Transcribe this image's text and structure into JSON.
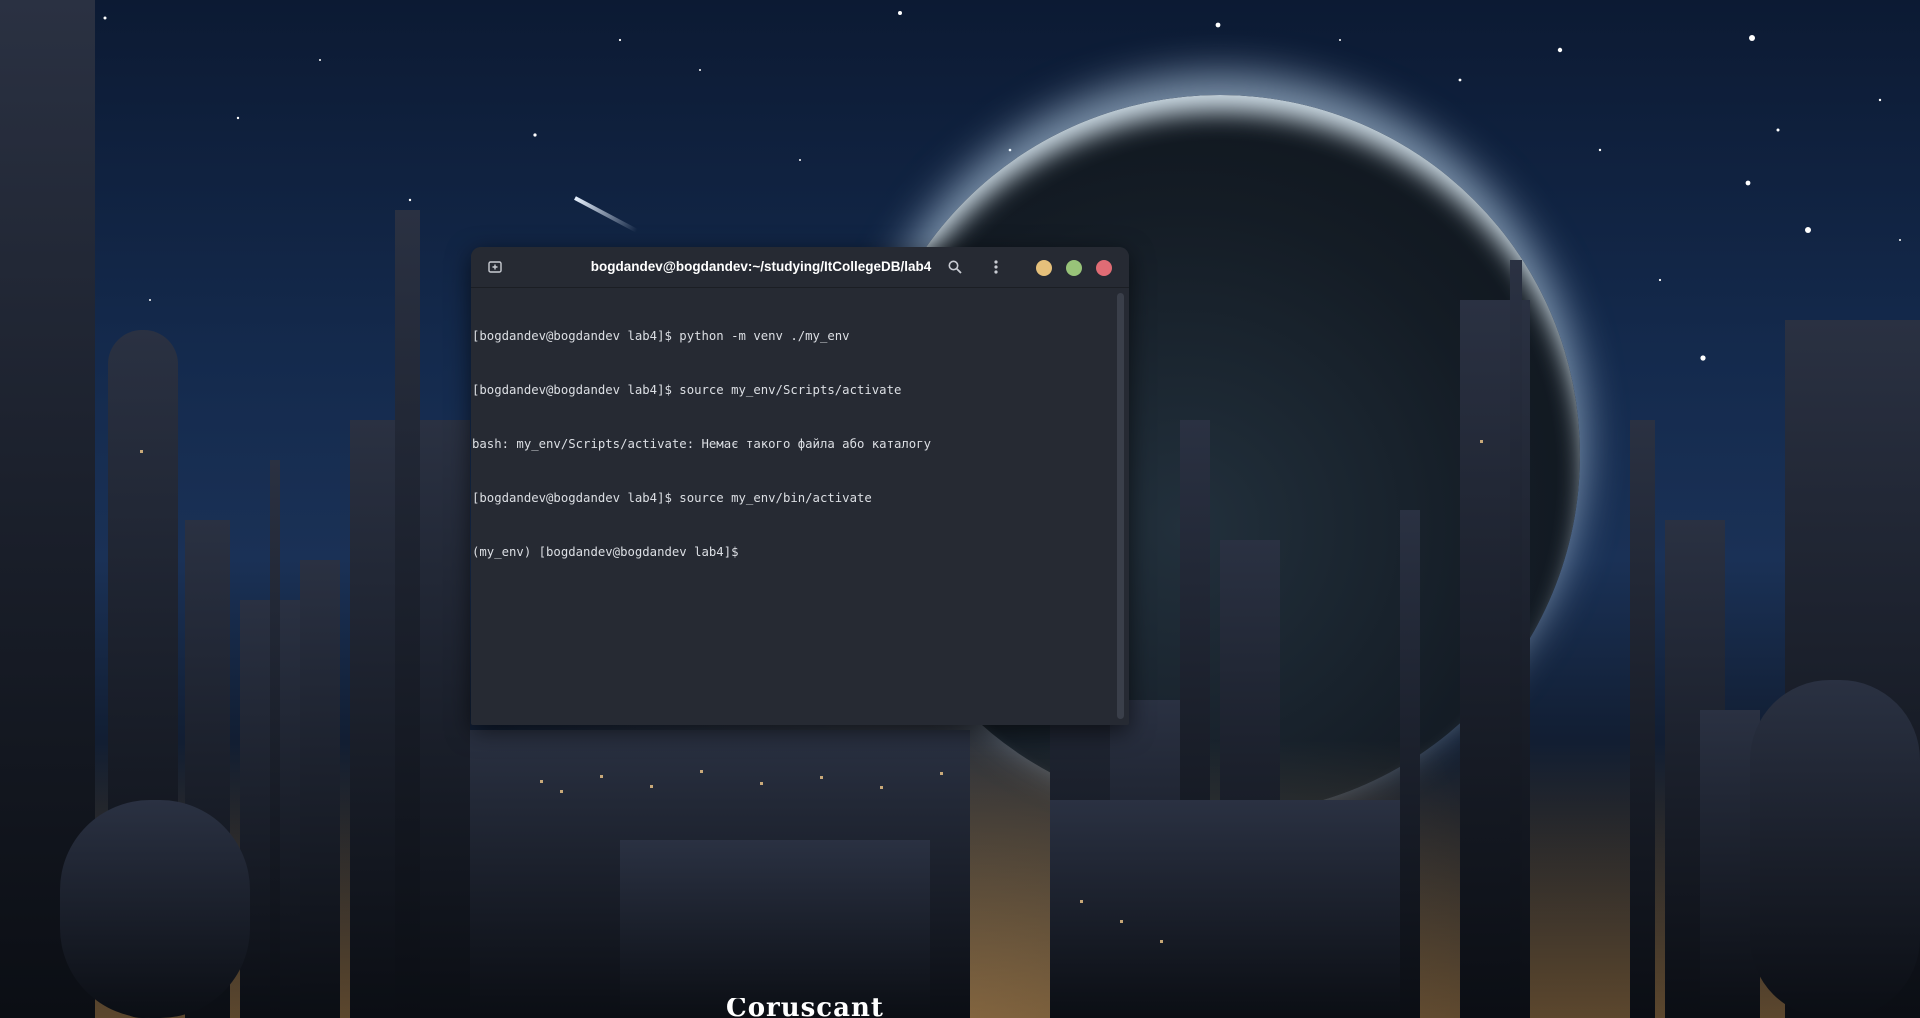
{
  "terminal": {
    "title": "bogdandev@bogdandev:~/studying/ItCollegeDB/lab4",
    "lines": [
      "[bogdandev@bogdandev lab4]$ python -m venv ./my_env",
      "[bogdandev@bogdandev lab4]$ source my_env/Scripts/activate",
      "bash: my_env/Scripts/activate: Немає такого файла або каталогу",
      "[bogdandev@bogdandev lab4]$ source my_env/bin/activate",
      "(my_env) [bogdandev@bogdandev lab4]$"
    ],
    "icons": {
      "new_tab": "new-tab-icon",
      "search": "search-icon",
      "menu": "kebab-menu-icon"
    },
    "colors": {
      "background": "#262a33",
      "text": "#dcdfe4",
      "minimize": "#e5c07b",
      "maximize": "#98c379",
      "close": "#e06c75"
    }
  },
  "wallpaper": {
    "caption": "Coruscant"
  }
}
